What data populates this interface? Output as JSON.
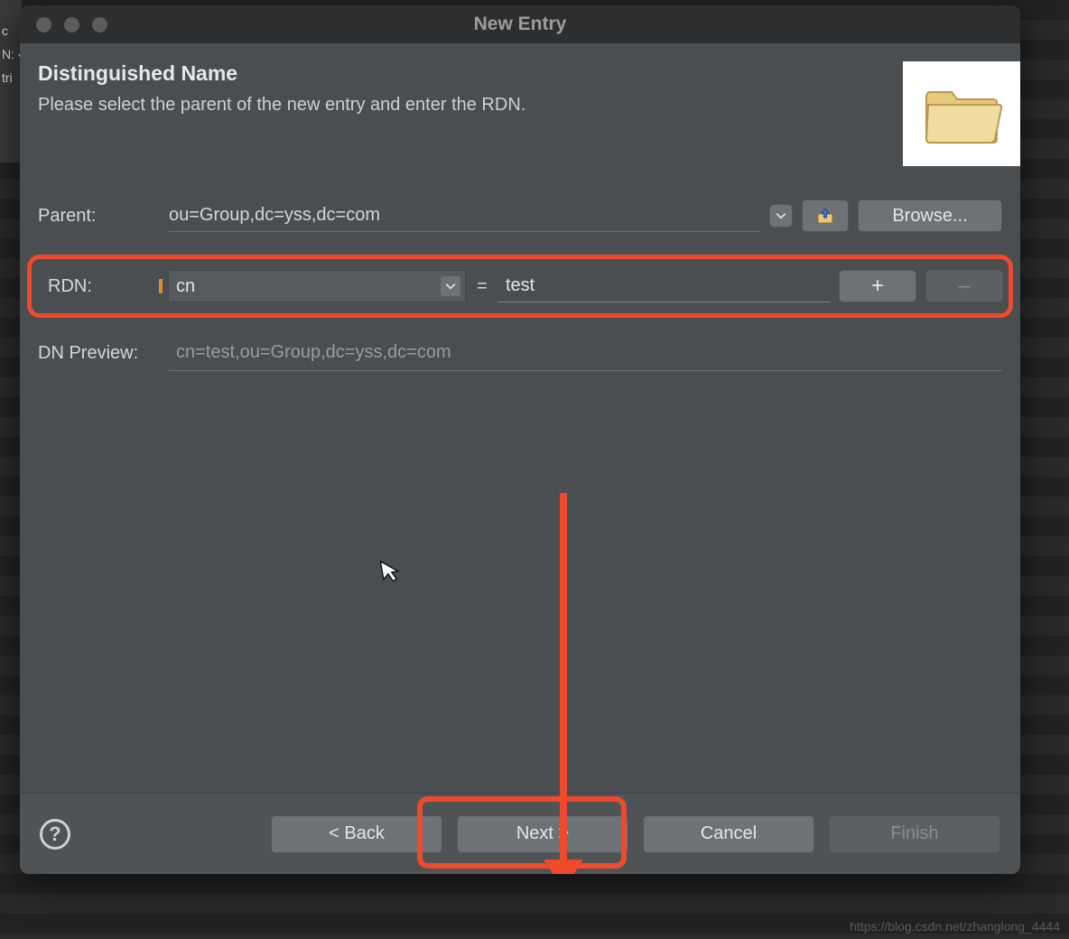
{
  "window": {
    "title": "New Entry"
  },
  "header": {
    "title": "Distinguished Name",
    "subtitle": "Please select the parent of the new entry and enter the RDN."
  },
  "form": {
    "parent_label": "Parent:",
    "parent_value": "ou=Group,dc=yss,dc=com",
    "browse_label": "Browse...",
    "rdn_label": "RDN:",
    "rdn_attr": "cn",
    "rdn_eq": "=",
    "rdn_value": "test",
    "plus_label": "+",
    "minus_label": "–",
    "preview_label": "DN Preview:",
    "preview_value": "cn=test,ou=Group,dc=yss,dc=com"
  },
  "footer": {
    "back": "< Back",
    "next": "Next >",
    "cancel": "Cancel",
    "finish": "Finish"
  },
  "left_sliver": {
    "l1": "c",
    "l2": "N: ‹",
    "l3": "tri"
  },
  "watermark": "https://blog.csdn.net/zhanglong_4444"
}
